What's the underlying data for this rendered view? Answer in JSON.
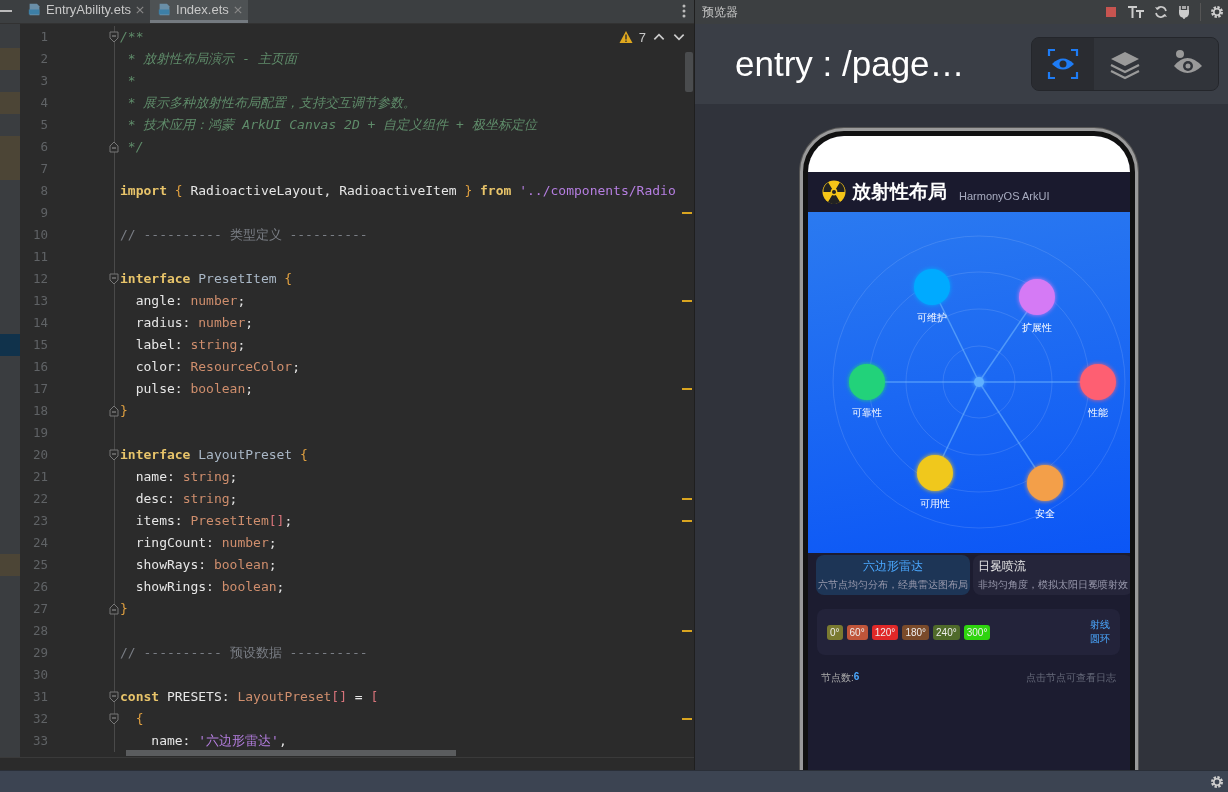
{
  "editor": {
    "tabs": [
      {
        "label": "EntryAbility.ets",
        "selected": false
      },
      {
        "label": "Index.ets",
        "selected": true
      }
    ],
    "inspection": {
      "count": "7"
    },
    "lines": [
      {
        "number": "1",
        "fold_start": true,
        "tokens": [
          {
            "kind": "doc",
            "text": "/**"
          }
        ]
      },
      {
        "number": "2",
        "changed": true,
        "tokens": [
          {
            "kind": "doc",
            "text": " * 放射性布局演示 - 主页面"
          }
        ]
      },
      {
        "number": "3",
        "tokens": [
          {
            "kind": "doc",
            "text": " *"
          }
        ]
      },
      {
        "number": "4",
        "changed": true,
        "tokens": [
          {
            "kind": "doc",
            "text": " * 展示多种放射性布局配置，支持交互调节参数。"
          }
        ]
      },
      {
        "number": "5",
        "tokens": [
          {
            "kind": "doc",
            "text": " * 技术应用：鸿蒙 ArkUI Canvas 2D + 自定义组件 + 极坐标定位"
          }
        ]
      },
      {
        "number": "6",
        "fold_end": true,
        "changed": true,
        "tokens": [
          {
            "kind": "doc",
            "text": " */"
          }
        ]
      },
      {
        "number": "7",
        "changed": true
      },
      {
        "number": "8",
        "tokens": [
          {
            "kind": "keyword",
            "text": "import"
          },
          {
            "kind": "brace",
            "text": " {"
          },
          {
            "kind": "plain",
            "text": " RadioactiveLayout, RadioactiveItem "
          },
          {
            "kind": "brace",
            "text": "}"
          },
          {
            "kind": "keyword",
            "text": " from"
          },
          {
            "kind": "string",
            "text": " '../components/Radio"
          }
        ]
      },
      {
        "number": "9",
        "warn": true
      },
      {
        "number": "10",
        "tokens": [
          {
            "kind": "comment",
            "text": "// ---------- 类型定义 ----------"
          }
        ]
      },
      {
        "number": "11"
      },
      {
        "number": "12",
        "fold_start": true,
        "tokens": [
          {
            "kind": "keyword",
            "text": "interface"
          },
          {
            "kind": "decl",
            "text": " PresetItem"
          },
          {
            "kind": "brace",
            "text": " {"
          }
        ]
      },
      {
        "number": "13",
        "warn": true,
        "tokens": [
          {
            "kind": "plain",
            "text": "  angle: "
          },
          {
            "kind": "type",
            "text": "number"
          },
          {
            "kind": "plain",
            "text": ";"
          }
        ]
      },
      {
        "number": "14",
        "tokens": [
          {
            "kind": "plain",
            "text": "  radius: "
          },
          {
            "kind": "type",
            "text": "number"
          },
          {
            "kind": "plain",
            "text": ";"
          }
        ]
      },
      {
        "number": "15",
        "current": true,
        "tokens": [
          {
            "kind": "plain",
            "text": "  label: "
          },
          {
            "kind": "type",
            "text": "string"
          },
          {
            "kind": "plain",
            "text": ";"
          }
        ]
      },
      {
        "number": "16",
        "tokens": [
          {
            "kind": "plain",
            "text": "  color: "
          },
          {
            "kind": "type",
            "text": "ResourceColor"
          },
          {
            "kind": "plain",
            "text": ";"
          }
        ]
      },
      {
        "number": "17",
        "warn": true,
        "tokens": [
          {
            "kind": "plain",
            "text": "  pulse: "
          },
          {
            "kind": "type",
            "text": "boolean"
          },
          {
            "kind": "plain",
            "text": ";"
          }
        ]
      },
      {
        "number": "18",
        "fold_end": true,
        "tokens": [
          {
            "kind": "brace",
            "text": "}"
          }
        ]
      },
      {
        "number": "19"
      },
      {
        "number": "20",
        "fold_start": true,
        "tokens": [
          {
            "kind": "keyword",
            "text": "interface"
          },
          {
            "kind": "decl",
            "text": " LayoutPreset"
          },
          {
            "kind": "brace",
            "text": " {"
          }
        ]
      },
      {
        "number": "21",
        "tokens": [
          {
            "kind": "plain",
            "text": "  name: "
          },
          {
            "kind": "type",
            "text": "string"
          },
          {
            "kind": "plain",
            "text": ";"
          }
        ]
      },
      {
        "number": "22",
        "warn": true,
        "tokens": [
          {
            "kind": "plain",
            "text": "  desc: "
          },
          {
            "kind": "type",
            "text": "string"
          },
          {
            "kind": "plain",
            "text": ";"
          }
        ]
      },
      {
        "number": "23",
        "warn": true,
        "tokens": [
          {
            "kind": "plain",
            "text": "  items: "
          },
          {
            "kind": "type",
            "text": "PresetItem"
          },
          {
            "kind": "bracket",
            "text": "[]"
          },
          {
            "kind": "plain",
            "text": ";"
          }
        ]
      },
      {
        "number": "24",
        "tokens": [
          {
            "kind": "plain",
            "text": "  ringCount: "
          },
          {
            "kind": "type",
            "text": "number"
          },
          {
            "kind": "plain",
            "text": ";"
          }
        ]
      },
      {
        "number": "25",
        "changed": true,
        "tokens": [
          {
            "kind": "plain",
            "text": "  showRays: "
          },
          {
            "kind": "type",
            "text": "boolean"
          },
          {
            "kind": "plain",
            "text": ";"
          }
        ]
      },
      {
        "number": "26",
        "tokens": [
          {
            "kind": "plain",
            "text": "  showRings: "
          },
          {
            "kind": "type",
            "text": "boolean"
          },
          {
            "kind": "plain",
            "text": ";"
          }
        ]
      },
      {
        "number": "27",
        "fold_end": true,
        "tokens": [
          {
            "kind": "brace",
            "text": "}"
          }
        ]
      },
      {
        "number": "28",
        "warn": true
      },
      {
        "number": "29",
        "tokens": [
          {
            "kind": "comment",
            "text": "// ---------- 预设数据 ----------"
          }
        ]
      },
      {
        "number": "30"
      },
      {
        "number": "31",
        "fold_start": true,
        "tokens": [
          {
            "kind": "keyword",
            "text": "const"
          },
          {
            "kind": "plain",
            "text": " PRESETS: "
          },
          {
            "kind": "type",
            "text": "LayoutPreset"
          },
          {
            "kind": "bracket",
            "text": "[]"
          },
          {
            "kind": "plain",
            "text": " = "
          },
          {
            "kind": "bracket",
            "text": "["
          }
        ]
      },
      {
        "number": "32",
        "fold_start": true,
        "warn": true,
        "tokens": [
          {
            "kind": "brace",
            "text": "  {"
          }
        ]
      },
      {
        "number": "33",
        "tokens": [
          {
            "kind": "plain",
            "text": "    name: "
          },
          {
            "kind": "string",
            "text": "'六边形雷达'"
          },
          {
            "kind": "plain",
            "text": ","
          }
        ]
      }
    ]
  },
  "preview": {
    "title": "预览器",
    "path": "entry : /page…",
    "view_modes": [
      {
        "kind": "inspect",
        "selected": true
      },
      {
        "kind": "layers",
        "selected": false
      },
      {
        "kind": "component",
        "selected": false
      }
    ],
    "app": {
      "title": "放射性布局",
      "subtitle": "HarmonyOS ArkUI",
      "nodes": [
        {
          "label": "性能",
          "color": "#fe5f72"
        },
        {
          "label": "安全",
          "color": "#f39f4a"
        },
        {
          "label": "可用性",
          "color": "#f0c81e"
        },
        {
          "label": "可靠性",
          "color": "#22d27a"
        },
        {
          "label": "可维护",
          "color": "#00aaff"
        },
        {
          "label": "扩展性",
          "color": "#d57af5"
        }
      ],
      "presets": [
        {
          "name": "六边形雷达",
          "desc": "六节点均匀分布，经典雷达图布局",
          "selected": true
        },
        {
          "name": "日冕喷流",
          "desc": "非均匀角度，模拟太阳日冕喷射效",
          "selected": false
        }
      ],
      "angles": [
        {
          "label": "0°",
          "color": "#7a7a30"
        },
        {
          "label": "60°",
          "color": "#c0553a"
        },
        {
          "label": "120°",
          "color": "#e02828"
        },
        {
          "label": "180°",
          "color": "#7a4a2a"
        },
        {
          "label": "240°",
          "color": "#4f6a2a"
        },
        {
          "label": "300°",
          "color": "#2ed40e"
        }
      ],
      "toggles": [
        {
          "label": "射线",
          "on": true
        },
        {
          "label": "圆环",
          "on": true
        }
      ],
      "count_label": "节点数: ",
      "count": "6",
      "hint": "点击节点可查看日志"
    }
  }
}
